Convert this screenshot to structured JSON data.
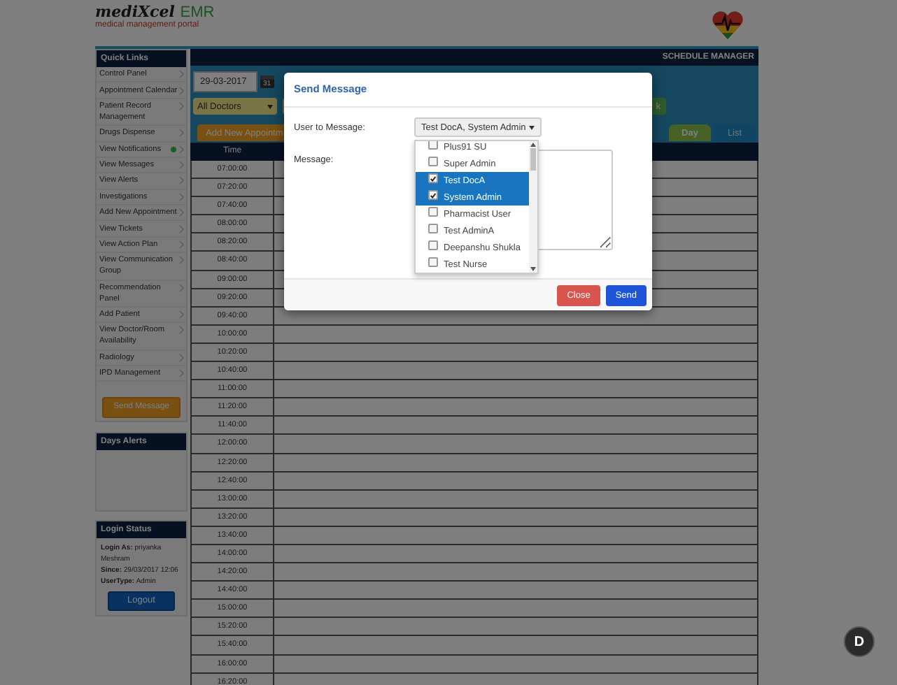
{
  "header": {
    "logo_name": "mediXcel",
    "logo_suffix": "EMR",
    "tagline": "medical management portal"
  },
  "quick_links": {
    "title": "Quick Links",
    "items": [
      {
        "label": "Control Panel",
        "notification": false
      },
      {
        "label": "Appointment Calendar",
        "notification": false
      },
      {
        "label": "Patient Record Management",
        "notification": false
      },
      {
        "label": "Drugs Dispense",
        "notification": false
      },
      {
        "label": "View Notifications",
        "notification": true
      },
      {
        "label": "View Messages",
        "notification": false
      },
      {
        "label": "View Alerts",
        "notification": false
      },
      {
        "label": "Investigations",
        "notification": false
      },
      {
        "label": "Add New Appointment",
        "notification": false
      },
      {
        "label": "View Tickets",
        "notification": false
      },
      {
        "label": "View Action Plan",
        "notification": false
      },
      {
        "label": "View Communication Group",
        "notification": false
      },
      {
        "label": "Recommendation Panel",
        "notification": false
      },
      {
        "label": "Add Patient",
        "notification": false
      },
      {
        "label": "View Doctor/Room Availability",
        "notification": false
      },
      {
        "label": "Radiology",
        "notification": false
      },
      {
        "label": "IPD Management",
        "notification": false
      }
    ],
    "send_button": "Send Message"
  },
  "days_alerts": {
    "title": "Days Alerts"
  },
  "login_status": {
    "title": "Login Status",
    "lines": [
      "**Login As:** priyanka Meshram",
      "**Since:** 29/03/2017 12:06",
      "**UserType:** Admin"
    ],
    "logout": "Logout"
  },
  "schedule": {
    "title": "SCHEDULE MANAGER",
    "date": "29-03-2017",
    "calendar_day": "31",
    "doctor_filter": "All Doctors",
    "go_button": "k",
    "add_button": "Add New Appointm",
    "views": [
      {
        "label": "Day",
        "selected": true
      },
      {
        "label": "List",
        "selected": false
      }
    ],
    "time_header": "Time",
    "times": [
      "07:00:00",
      "07:20:00",
      "07:40:00",
      "08:00:00",
      "08:20:00",
      "08:40:00",
      "09:00:00",
      "09:20:00",
      "09:40:00",
      "10:00:00",
      "10:20:00",
      "10:40:00",
      "11:00:00",
      "11:20:00",
      "11:40:00",
      "12:00:00",
      "12:20:00",
      "12:40:00",
      "13:00:00",
      "13:20:00",
      "13:40:00",
      "14:00:00",
      "14:20:00",
      "14:40:00",
      "15:00:00",
      "15:20:00",
      "15:40:00",
      "16:00:00",
      "16:20:00"
    ]
  },
  "dialog": {
    "title": "Send Message",
    "user_label": "User to Message:",
    "user_value": "Test DocA, System Admin",
    "message_label": "Message:",
    "users": [
      {
        "name": "Plus91 SU",
        "checked": false
      },
      {
        "name": "Super Admin",
        "checked": false
      },
      {
        "name": "Test DocA",
        "checked": true
      },
      {
        "name": "System Admin",
        "checked": true
      },
      {
        "name": "Pharmacist User",
        "checked": false
      },
      {
        "name": "Test AdminA",
        "checked": false
      },
      {
        "name": "Deepanshu Shukla",
        "checked": false
      },
      {
        "name": "Test Nurse",
        "checked": false
      }
    ],
    "buttons": [
      {
        "label": "Close",
        "kind": "danger"
      },
      {
        "label": "Send",
        "kind": "primary"
      }
    ]
  },
  "profile_badge": "D"
}
